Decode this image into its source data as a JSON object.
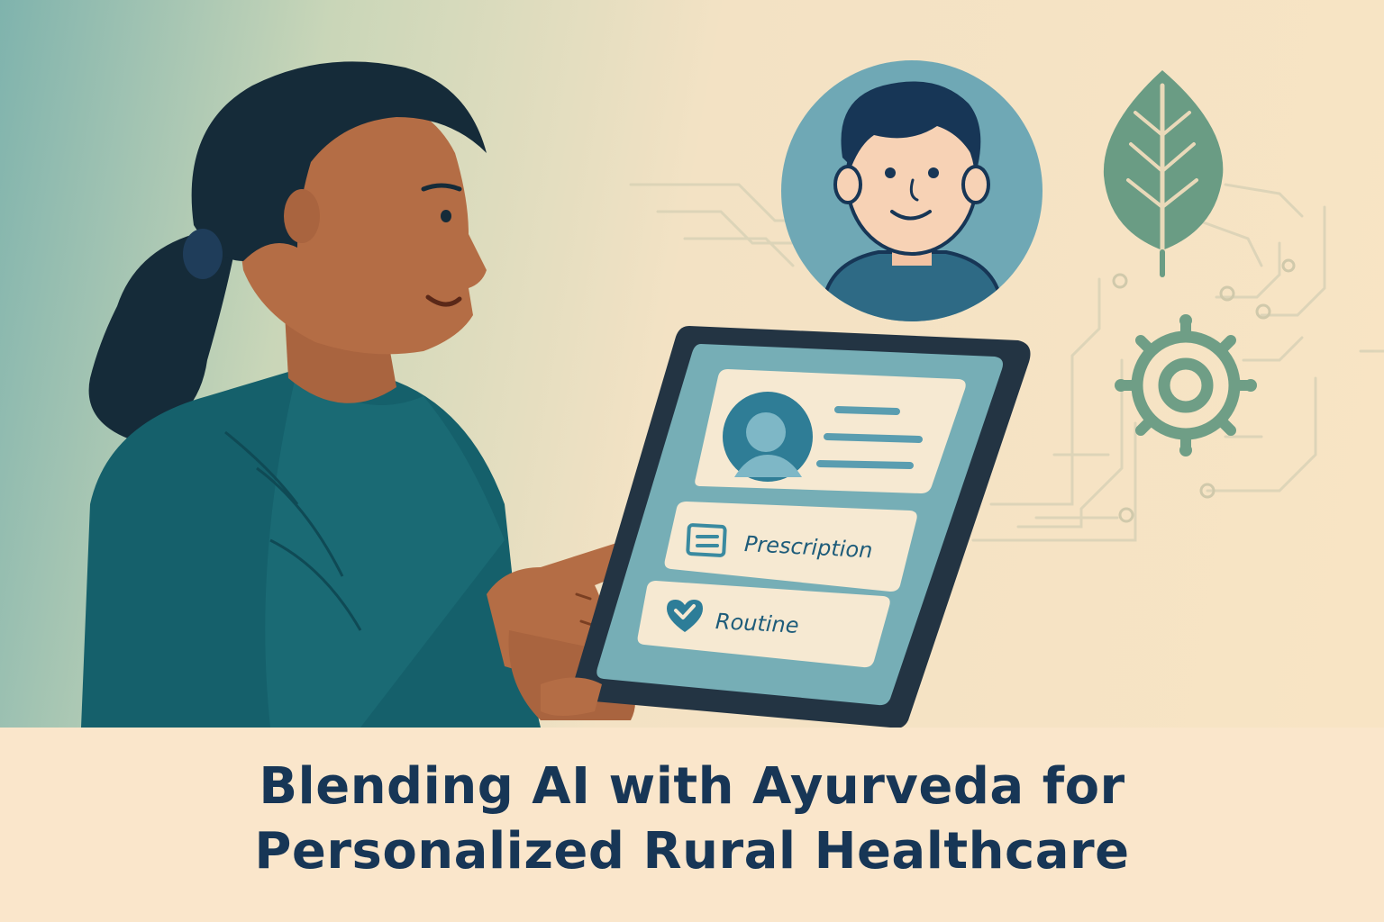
{
  "title": {
    "line1": "Blending AI with Ayurveda for",
    "line2": "Personalized Rural Healthcare"
  },
  "tablet": {
    "profile_card": {
      "avatar_icon": "patient-avatar"
    },
    "buttons": [
      {
        "label": "Prescription",
        "icon": "document-icon"
      },
      {
        "label": "Routine",
        "icon": "heart-check-icon"
      }
    ]
  },
  "icons": [
    "doctor-avatar",
    "leaf-icon",
    "wheel-icon",
    "circuit-lines"
  ],
  "colors": {
    "caption_text": "#173656",
    "caption_band": "#fae6cb",
    "teal_dark": "#1d5a6b",
    "leaf_green": "#6a9c84",
    "tablet_frame": "#233443"
  }
}
